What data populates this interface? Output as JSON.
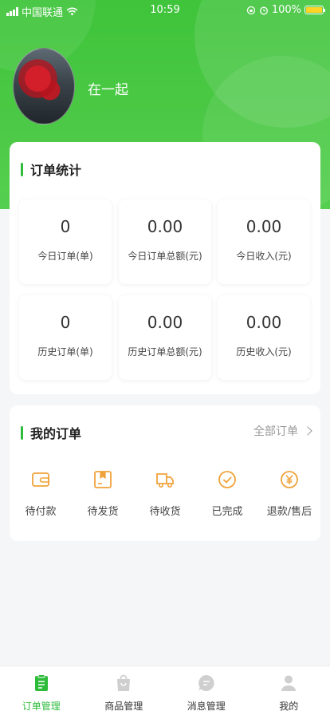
{
  "status_bar": {
    "carrier": "中国联通",
    "time": "10:59",
    "battery": "100%"
  },
  "profile": {
    "name": "在一起"
  },
  "stats": {
    "title": "订单统计",
    "items": [
      {
        "value": "0",
        "label": "今日订单(单)"
      },
      {
        "value": "0.00",
        "label": "今日订单总额(元)"
      },
      {
        "value": "0.00",
        "label": "今日收入(元)"
      },
      {
        "value": "0",
        "label": "历史订单(单)"
      },
      {
        "value": "0.00",
        "label": "历史订单总额(元)"
      },
      {
        "value": "0.00",
        "label": "历史收入(元)"
      }
    ]
  },
  "orders": {
    "title": "我的订单",
    "all_label": "全部订单",
    "items": [
      {
        "label": "待付款",
        "icon": "wallet-icon"
      },
      {
        "label": "待发货",
        "icon": "package-icon"
      },
      {
        "label": "待收货",
        "icon": "truck-icon"
      },
      {
        "label": "已完成",
        "icon": "check-circle-icon"
      },
      {
        "label": "退款/售后",
        "icon": "refund-icon"
      }
    ]
  },
  "tabbar": {
    "items": [
      {
        "label": "订单管理",
        "icon": "order-list-icon",
        "active": true
      },
      {
        "label": "商品管理",
        "icon": "shopping-bag-icon",
        "active": false
      },
      {
        "label": "消息管理",
        "icon": "message-icon",
        "active": false
      },
      {
        "label": "我的",
        "icon": "user-icon",
        "active": false
      }
    ]
  },
  "colors": {
    "brand_green": "#3fc43b",
    "accent_green": "#2dbb3a",
    "icon_orange": "#f0a23a"
  }
}
